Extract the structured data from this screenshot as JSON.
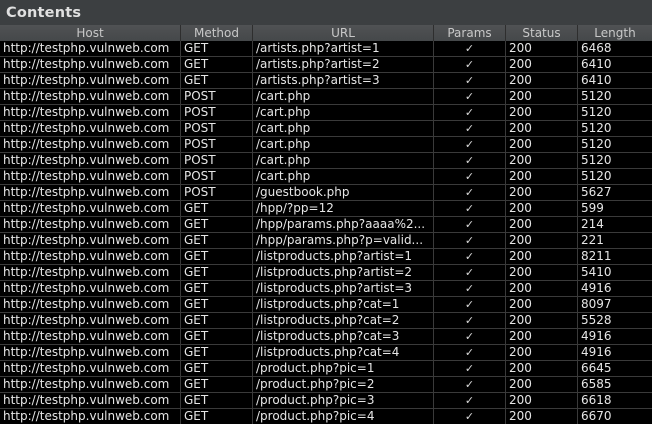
{
  "panel": {
    "title": "Contents"
  },
  "columns": [
    "Host",
    "Method",
    "URL",
    "Params",
    "Status",
    "Length"
  ],
  "rows": [
    {
      "host": "http://testphp.vulnweb.com",
      "method": "GET",
      "url": "/artists.php?artist=1",
      "params": "✓",
      "status": "200",
      "length": "6468"
    },
    {
      "host": "http://testphp.vulnweb.com",
      "method": "GET",
      "url": "/artists.php?artist=2",
      "params": "✓",
      "status": "200",
      "length": "6410"
    },
    {
      "host": "http://testphp.vulnweb.com",
      "method": "GET",
      "url": "/artists.php?artist=3",
      "params": "✓",
      "status": "200",
      "length": "6410"
    },
    {
      "host": "http://testphp.vulnweb.com",
      "method": "POST",
      "url": "/cart.php",
      "params": "✓",
      "status": "200",
      "length": "5120"
    },
    {
      "host": "http://testphp.vulnweb.com",
      "method": "POST",
      "url": "/cart.php",
      "params": "✓",
      "status": "200",
      "length": "5120"
    },
    {
      "host": "http://testphp.vulnweb.com",
      "method": "POST",
      "url": "/cart.php",
      "params": "✓",
      "status": "200",
      "length": "5120"
    },
    {
      "host": "http://testphp.vulnweb.com",
      "method": "POST",
      "url": "/cart.php",
      "params": "✓",
      "status": "200",
      "length": "5120"
    },
    {
      "host": "http://testphp.vulnweb.com",
      "method": "POST",
      "url": "/cart.php",
      "params": "✓",
      "status": "200",
      "length": "5120"
    },
    {
      "host": "http://testphp.vulnweb.com",
      "method": "POST",
      "url": "/cart.php",
      "params": "✓",
      "status": "200",
      "length": "5120"
    },
    {
      "host": "http://testphp.vulnweb.com",
      "method": "POST",
      "url": "/guestbook.php",
      "params": "✓",
      "status": "200",
      "length": "5627"
    },
    {
      "host": "http://testphp.vulnweb.com",
      "method": "GET",
      "url": "/hpp/?pp=12",
      "params": "✓",
      "status": "200",
      "length": "599"
    },
    {
      "host": "http://testphp.vulnweb.com",
      "method": "GET",
      "url": "/hpp/params.php?aaaa%2...",
      "params": "✓",
      "status": "200",
      "length": "214"
    },
    {
      "host": "http://testphp.vulnweb.com",
      "method": "GET",
      "url": "/hpp/params.php?p=valid...",
      "params": "✓",
      "status": "200",
      "length": "221"
    },
    {
      "host": "http://testphp.vulnweb.com",
      "method": "GET",
      "url": "/listproducts.php?artist=1",
      "params": "✓",
      "status": "200",
      "length": "8211"
    },
    {
      "host": "http://testphp.vulnweb.com",
      "method": "GET",
      "url": "/listproducts.php?artist=2",
      "params": "✓",
      "status": "200",
      "length": "5410"
    },
    {
      "host": "http://testphp.vulnweb.com",
      "method": "GET",
      "url": "/listproducts.php?artist=3",
      "params": "✓",
      "status": "200",
      "length": "4916"
    },
    {
      "host": "http://testphp.vulnweb.com",
      "method": "GET",
      "url": "/listproducts.php?cat=1",
      "params": "✓",
      "status": "200",
      "length": "8097"
    },
    {
      "host": "http://testphp.vulnweb.com",
      "method": "GET",
      "url": "/listproducts.php?cat=2",
      "params": "✓",
      "status": "200",
      "length": "5528"
    },
    {
      "host": "http://testphp.vulnweb.com",
      "method": "GET",
      "url": "/listproducts.php?cat=3",
      "params": "✓",
      "status": "200",
      "length": "4916"
    },
    {
      "host": "http://testphp.vulnweb.com",
      "method": "GET",
      "url": "/listproducts.php?cat=4",
      "params": "✓",
      "status": "200",
      "length": "4916"
    },
    {
      "host": "http://testphp.vulnweb.com",
      "method": "GET",
      "url": "/product.php?pic=1",
      "params": "✓",
      "status": "200",
      "length": "6645"
    },
    {
      "host": "http://testphp.vulnweb.com",
      "method": "GET",
      "url": "/product.php?pic=2",
      "params": "✓",
      "status": "200",
      "length": "6585"
    },
    {
      "host": "http://testphp.vulnweb.com",
      "method": "GET",
      "url": "/product.php?pic=3",
      "params": "✓",
      "status": "200",
      "length": "6618"
    },
    {
      "host": "http://testphp.vulnweb.com",
      "method": "GET",
      "url": "/product.php?pic=4",
      "params": "✓",
      "status": "200",
      "length": "6670"
    }
  ]
}
